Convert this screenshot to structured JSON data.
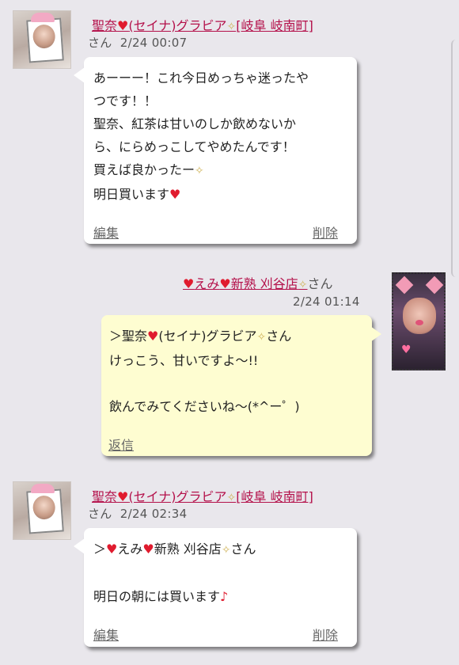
{
  "messages": [
    {
      "sender": "聖奈",
      "sender_suffix": "(セイナ)グラビア",
      "sender_location": "[岐阜 岐南町]",
      "honorific": "さん",
      "date": "2/24 00:07",
      "lines": [
        "あーーー！これ今日めっちゃ迷ったや",
        "つです！！",
        "聖奈、紅茶は甘いのしか飲めないか",
        "ら、にらめっこしてやめたんです！",
        "買えば良かったー",
        "明日買います"
      ],
      "edit_label": "編集",
      "delete_label": "削除"
    },
    {
      "sender_prefix": "えみ",
      "sender_name": "新熟 刈谷店",
      "honorific": "さん",
      "date": "2/24 01:14",
      "lines": [
        "＞聖奈",
        "(セイナ)グラビア",
        "さん",
        "けっこう、甘いですよ～!!",
        "飲んでみてくださいね～(*^ー゜)"
      ],
      "reply_label": "返信"
    },
    {
      "sender": "聖奈",
      "sender_suffix": "(セイナ)グラビア",
      "sender_location": "[岐阜 岐南町]",
      "honorific": "さん",
      "date": "2/24 02:34",
      "lines": [
        "＞",
        "えみ",
        "新熟 刈谷店",
        "さん",
        "明日の朝には買います"
      ],
      "edit_label": "編集",
      "delete_label": "削除"
    }
  ],
  "icons": {
    "heart": "♥",
    "sparkle": "✧",
    "music_note": "♪"
  },
  "colors": {
    "name": "#b4104a",
    "heart": "#e01b2e",
    "bubble_self": "#fefdd1",
    "bubble_other": "#ffffff",
    "background": "#e9e7ec"
  }
}
